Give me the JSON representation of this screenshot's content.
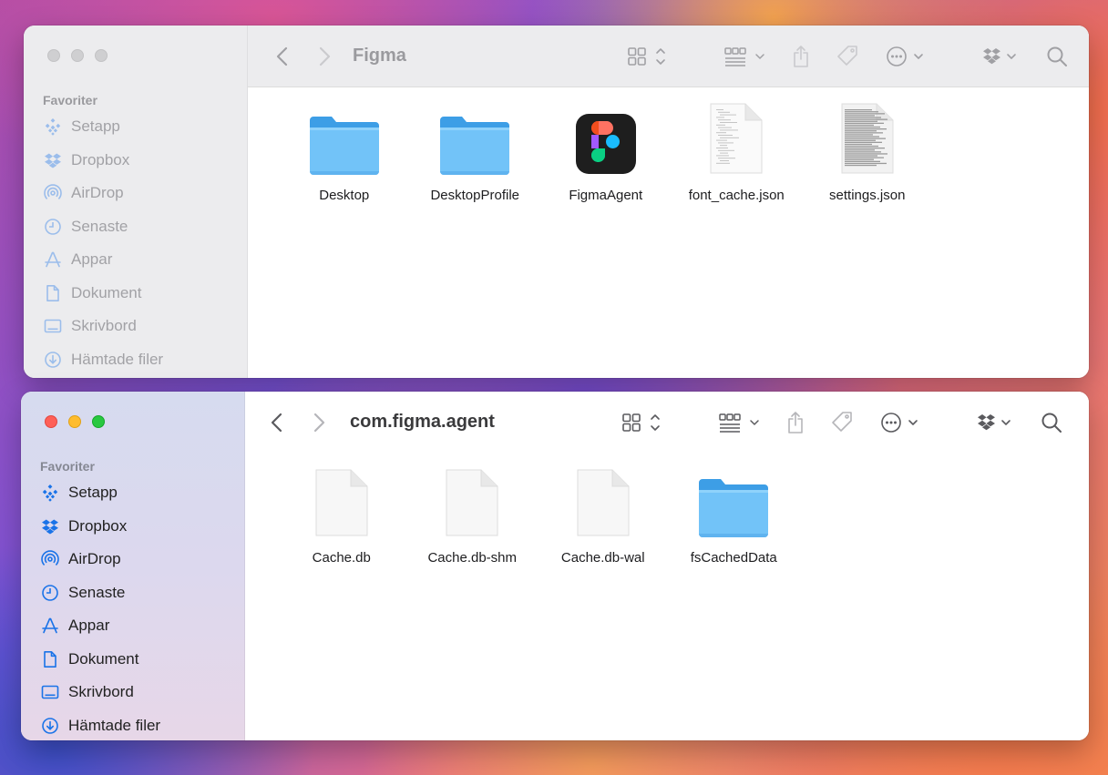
{
  "windows": [
    {
      "title": "Figma",
      "active": false,
      "sidebar": {
        "header": "Favoriter",
        "items": [
          {
            "label": "Setapp",
            "icon": "setapp-icon"
          },
          {
            "label": "Dropbox",
            "icon": "dropbox-icon"
          },
          {
            "label": "AirDrop",
            "icon": "airdrop-icon"
          },
          {
            "label": "Senaste",
            "icon": "clock-icon"
          },
          {
            "label": "Appar",
            "icon": "apps-icon"
          },
          {
            "label": "Dokument",
            "icon": "document-icon"
          },
          {
            "label": "Skrivbord",
            "icon": "desktop-icon"
          },
          {
            "label": "Hämtade filer",
            "icon": "download-icon"
          }
        ]
      },
      "files": [
        {
          "name": "Desktop",
          "type": "folder"
        },
        {
          "name": "DesktopProfile",
          "type": "folder"
        },
        {
          "name": "FigmaAgent",
          "type": "app"
        },
        {
          "name": "font_cache.json",
          "type": "json-preview"
        },
        {
          "name": "settings.json",
          "type": "json-preview-dense"
        }
      ]
    },
    {
      "title": "com.figma.agent",
      "active": true,
      "sidebar": {
        "header": "Favoriter",
        "items": [
          {
            "label": "Setapp",
            "icon": "setapp-icon"
          },
          {
            "label": "Dropbox",
            "icon": "dropbox-icon"
          },
          {
            "label": "AirDrop",
            "icon": "airdrop-icon"
          },
          {
            "label": "Senaste",
            "icon": "clock-icon"
          },
          {
            "label": "Appar",
            "icon": "apps-icon"
          },
          {
            "label": "Dokument",
            "icon": "document-icon"
          },
          {
            "label": "Skrivbord",
            "icon": "desktop-icon"
          },
          {
            "label": "Hämtade filer",
            "icon": "download-icon"
          }
        ]
      },
      "files": [
        {
          "name": "Cache.db",
          "type": "blank"
        },
        {
          "name": "Cache.db-shm",
          "type": "blank"
        },
        {
          "name": "Cache.db-wal",
          "type": "blank"
        },
        {
          "name": "fsCachedData",
          "type": "folder"
        }
      ]
    }
  ],
  "colors": {
    "accent": "#1a73e8",
    "folder_top": "#7ecbfb",
    "folder_back": "#3d9ee6",
    "traffic_close": "#fe5f57",
    "traffic_min": "#febc2e",
    "traffic_max": "#28c840"
  }
}
